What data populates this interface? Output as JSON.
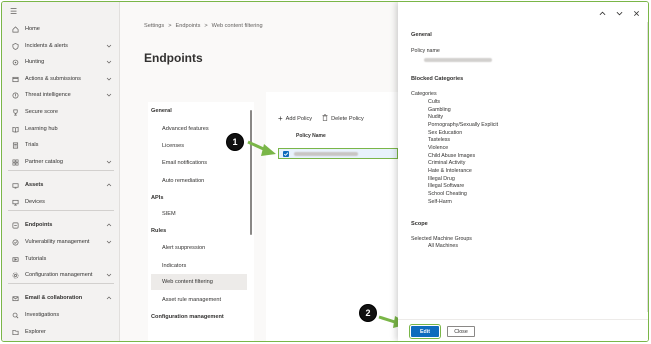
{
  "nav": {
    "items": [
      {
        "label": "Home",
        "icon": "home-icon",
        "chevron": false,
        "bold": false
      },
      {
        "label": "Incidents & alerts",
        "icon": "shield-alert-icon",
        "chevron": true,
        "bold": false
      },
      {
        "label": "Hunting",
        "icon": "hunting-icon",
        "chevron": true,
        "bold": false
      },
      {
        "label": "Actions & submissions",
        "icon": "actions-icon",
        "chevron": true,
        "bold": false
      },
      {
        "label": "Threat intelligence",
        "icon": "threat-intel-icon",
        "chevron": true,
        "bold": false
      },
      {
        "label": "Secure score",
        "icon": "trophy-icon",
        "chevron": false,
        "bold": false
      },
      {
        "label": "Learning hub",
        "icon": "book-icon",
        "chevron": false,
        "bold": false
      },
      {
        "label": "Trials",
        "icon": "trials-icon",
        "chevron": false,
        "bold": false
      },
      {
        "label": "Partner catalog",
        "icon": "partner-icon",
        "chevron": true,
        "bold": false
      },
      {
        "label": "Assets",
        "icon": "assets-icon",
        "chevron": true,
        "bold": true
      },
      {
        "label": "Devices",
        "icon": "devices-icon",
        "chevron": false,
        "bold": false
      },
      {
        "label": "Endpoints",
        "icon": "endpoints-icon",
        "chevron": true,
        "bold": true
      },
      {
        "label": "Vulnerability management",
        "icon": "vulnerability-icon",
        "chevron": true,
        "bold": false
      },
      {
        "label": "Tutorials",
        "icon": "tutorials-icon",
        "chevron": false,
        "bold": false
      },
      {
        "label": "Configuration management",
        "icon": "config-icon",
        "chevron": true,
        "bold": false
      },
      {
        "label": "Email & collaboration",
        "icon": "email-icon",
        "chevron": true,
        "bold": true
      },
      {
        "label": "Investigations",
        "icon": "investigations-icon",
        "chevron": false,
        "bold": false
      },
      {
        "label": "Explorer",
        "icon": "explorer-icon",
        "chevron": false,
        "bold": false
      }
    ]
  },
  "breadcrumb": [
    "Settings",
    ">",
    "Endpoints",
    ">",
    "Web content filtering"
  ],
  "page_title": "Endpoints",
  "settings": {
    "groups": [
      {
        "heading": "General",
        "items": [
          "Advanced features",
          "Licenses",
          "Email notifications",
          "Auto remediation"
        ]
      },
      {
        "heading": "APIs",
        "items": [
          "SIEM"
        ]
      },
      {
        "heading": "Rules",
        "items": [
          "Alert suppression",
          "Indicators",
          "Web content filtering",
          "Asset rule management"
        ]
      },
      {
        "heading": "Configuration management",
        "items": []
      }
    ],
    "active": "Web content filtering"
  },
  "toolbar": {
    "add_policy": "Add Policy",
    "delete_policy": "Delete Policy"
  },
  "table": {
    "column_policy_name": "Policy Name"
  },
  "callouts": {
    "one": "1",
    "two": "2"
  },
  "flyout": {
    "general_heading": "General",
    "policy_name_label": "Policy name",
    "blocked_heading": "Blocked Categories",
    "categories_label": "Categories",
    "categories": [
      "Cults",
      "Gambling",
      "Nudity",
      "Pornography/Sexually Explicit",
      "Sex Education",
      "Tasteless",
      "Violence",
      "Child Abuse Images",
      "Criminal Activity",
      "Hate & Intolerance",
      "Illegal Drug",
      "Illegal Software",
      "School Cheating",
      "Self-Harm"
    ],
    "scope_heading": "Scope",
    "scope_label": "Selected Machine Groups",
    "scope_value": "All Machines",
    "edit_button": "Edit",
    "close_button": "Close"
  },
  "colors": {
    "accent": "#0f6cbd",
    "highlight": "#7ab648"
  }
}
